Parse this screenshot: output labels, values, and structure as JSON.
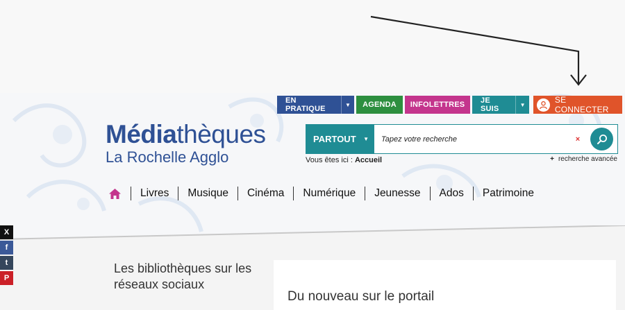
{
  "topnav": {
    "pratique": "EN PRATIQUE",
    "agenda": "AGENDA",
    "infolettres": "INFOLETTRES",
    "jesuis": "JE SUIS",
    "connect": "SE CONNECTER"
  },
  "logo": {
    "bold_part": "Média",
    "rest_part": "thèques",
    "subtitle": "La Rochelle Agglo"
  },
  "search": {
    "scope": "PARTOUT",
    "placeholder": "Tapez votre recherche",
    "clear": "×",
    "advanced": "recherche avancée",
    "advanced_prefix": "+"
  },
  "breadcrumb": {
    "prefix": "Vous êtes ici :",
    "current": "Accueil"
  },
  "menu": {
    "items": [
      "Livres",
      "Musique",
      "Cinéma",
      "Numérique",
      "Jeunesse",
      "Ados",
      "Patrimoine"
    ]
  },
  "share": {
    "x": "X",
    "facebook": "f",
    "tumblr": "t",
    "pinterest": "P"
  },
  "content": {
    "social_heading": "Les bibliothèques sur les réseaux sociaux",
    "panel_title": "Du nouveau sur le portail"
  },
  "colors": {
    "blue": "#2f5195",
    "green": "#2d8f3f",
    "pink": "#c4358d",
    "teal": "#1f8c94",
    "orange": "#e0542a"
  }
}
